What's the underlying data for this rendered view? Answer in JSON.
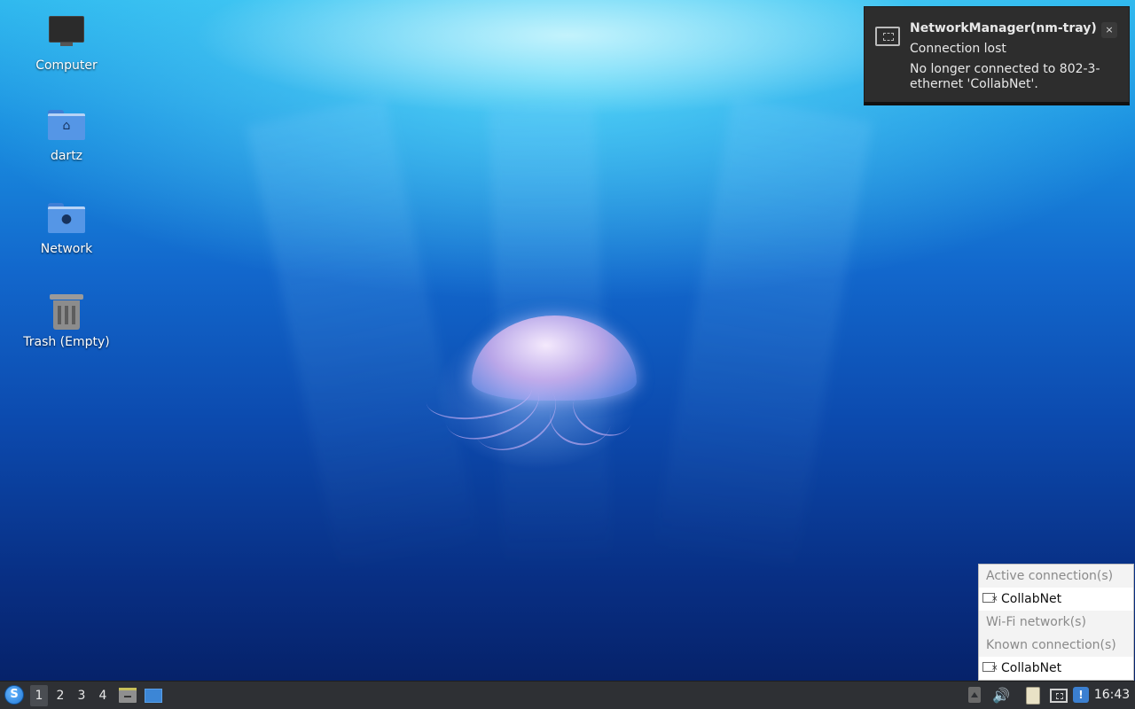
{
  "desktop": {
    "icons": [
      {
        "label": "Computer",
        "icon": "computer-icon"
      },
      {
        "label": "dartz",
        "icon": "home-folder-icon"
      },
      {
        "label": "Network",
        "icon": "network-folder-icon"
      },
      {
        "label": "Trash (Empty)",
        "icon": "trash-icon"
      }
    ]
  },
  "notification": {
    "app": "NetworkManager(nm-tray)",
    "summary": "Connection lost",
    "body": "No longer connected to 802-3-ethernet 'CollabNet'.",
    "close_glyph": "×",
    "icon": "ethernet-icon"
  },
  "network_menu": {
    "active_header": "Active connection(s)",
    "active_item": "CollabNet",
    "wifi_header": "Wi-Fi network(s)",
    "known_header": "Known connection(s)",
    "known_item": "CollabNet"
  },
  "taskbar": {
    "start_glyph": "S",
    "workspaces": [
      "1",
      "2",
      "3",
      "4"
    ],
    "active_workspace": "1",
    "volume_glyph": "🔊",
    "notice_glyph": "!",
    "clock": "16:43"
  },
  "colors": {
    "panel": "#2e3034",
    "folder": "#5596e6",
    "accent": "#1f78d6"
  }
}
